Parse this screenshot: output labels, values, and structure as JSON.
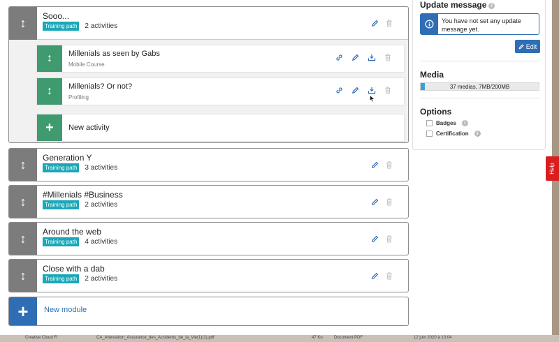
{
  "modules": [
    {
      "title": "Sooo...",
      "badge": "Training path",
      "count": "2 activities",
      "activities": [
        {
          "title": "Millenials as seen by Gabs",
          "type": "Mobile Course"
        },
        {
          "title": "Millenials? Or not?",
          "type": "Profiling"
        }
      ],
      "new_activity_label": "New activity"
    },
    {
      "title": "Generation Y",
      "badge": "Training path",
      "count": "3 activities"
    },
    {
      "title": "#Millenials #Business",
      "badge": "Training path",
      "count": "2 activities"
    },
    {
      "title": "Around the web",
      "badge": "Training path",
      "count": "4 activities"
    },
    {
      "title": "Close with a dab",
      "badge": "Training path",
      "count": "2 activities"
    }
  ],
  "new_module_label": "New module",
  "panel": {
    "update_message_title": "Update message",
    "update_message_text": "You have not set any update message yet.",
    "edit_label": "Edit",
    "media_title": "Media",
    "media_usage_text": "37 medias, 7MB/200MB",
    "media_usage_fraction": 0.035,
    "options_title": "Options",
    "options": [
      "Badges",
      "Certification"
    ]
  },
  "help_label": "Help",
  "taskbar": {
    "item1": "Creative Cloud Fi",
    "item2": "CA_Attestation_Assurance_des_Accidents_de_la_Vie(1)(1).pdf",
    "item3": "47 Ko",
    "item4": "Document PDF",
    "item5": "12 juin 2020 à 13:04"
  },
  "colors": {
    "accent_blue": "#2f6eb5",
    "badge_teal": "#1aa8b8",
    "handle_gray": "#7c7c7c",
    "handle_green": "#3f9a6f",
    "help_red": "#d91e1e"
  }
}
